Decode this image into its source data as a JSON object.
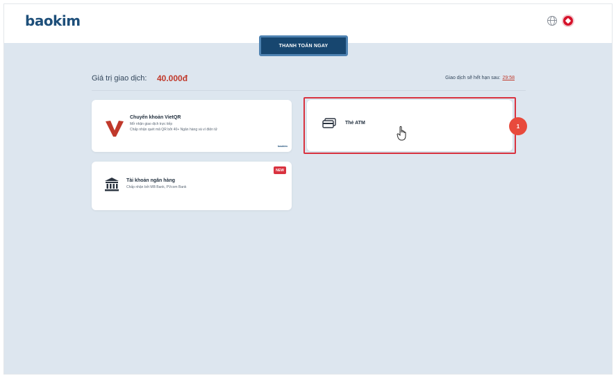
{
  "header": {
    "logo": "baokim",
    "language_icon": "globe-icon",
    "flag_icon": "vietnam-flag-icon"
  },
  "pay_now_label": "THANH TOÁN NGAY",
  "transaction": {
    "amount_label": "Giá trị giao dịch:",
    "amount_value": "40.000đ",
    "expire_label": "Giao dịch sẽ hết hạn sau:",
    "expire_time": "29:58"
  },
  "methods": {
    "vietqr": {
      "title": "Chuyển khoản VietQR",
      "line1": "Mở nhận giao dịch trực tiếp",
      "line2": "Chấp nhận quét mã QR bởi 40+ Ngân hàng và ví điện tử",
      "brand": "baokim"
    },
    "atm": {
      "label": "Thẻ ATM"
    },
    "bank": {
      "title": "Tài khoản ngân hàng",
      "sub": "Chấp nhận bởi MB Bank, PVcom Bank",
      "badge": "NEW"
    }
  },
  "annotation": {
    "step_number": "1"
  },
  "colors": {
    "brand": "#1e4f7a",
    "accent": "#c0392b",
    "highlight": "#d9323f",
    "background": "#dde6ef"
  }
}
